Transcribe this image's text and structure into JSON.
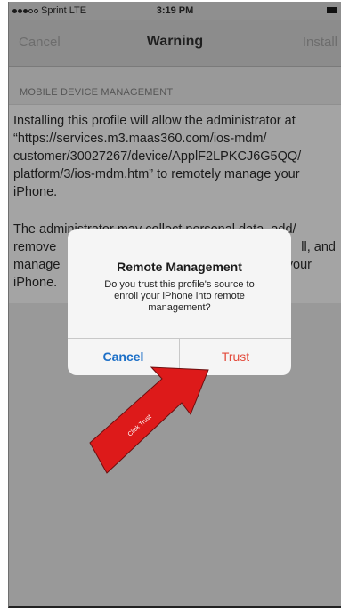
{
  "status_bar": {
    "carrier": "Sprint",
    "network": "LTE",
    "time": "3:19 PM"
  },
  "nav": {
    "cancel_label": "Cancel",
    "title": "Warning",
    "install_label": "Install"
  },
  "section": {
    "header": "MOBILE DEVICE MANAGEMENT",
    "para1_line1": "Installing this profile will allow the administrator at",
    "para1_line2": "“https://services.m3.maas360.com/ios-mdm/",
    "para1_line3": "customer/30027267/device/ApplF2LPKCJ6G5QQ/",
    "para1_line4": "platform/3/ios-mdm.htm” to remotely manage your",
    "para1_line5": "iPhone.",
    "para2_line1": "The administrator may collect personal data, add/",
    "para2_line2_start": "remove",
    "para2_line2_end": "ll, and",
    "para2_line3_start": "manage",
    "para2_line3_end": "your",
    "para2_line4": "iPhone."
  },
  "alert": {
    "title": "Remote Management",
    "message_line1": "Do you trust this profile's source to",
    "message_line2": "enroll your iPhone into remote",
    "message_line3": "management?",
    "cancel_label": "Cancel",
    "trust_label": "Trust"
  },
  "annotation": {
    "arrow_text": "Click Trust",
    "arrow_color": "#e01818"
  },
  "colors": {
    "overlay_gray": "#9e9e9e",
    "alert_bg": "#f5f5f5",
    "cancel_blue": "#1c6fc7",
    "trust_red": "#e34a3b"
  }
}
